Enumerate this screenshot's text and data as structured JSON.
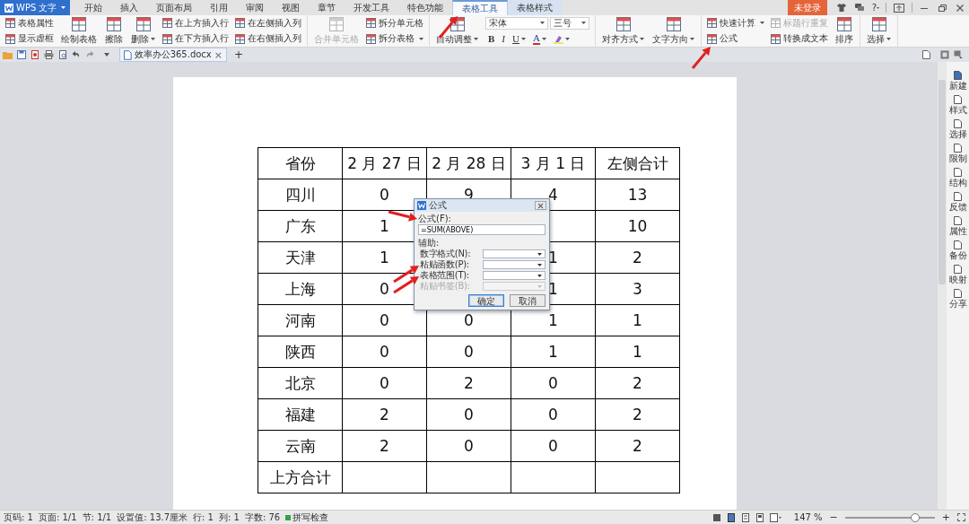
{
  "app_button": {
    "label": "WPS 文字"
  },
  "menu_tabs": [
    {
      "label": "开始",
      "selected": false,
      "contextual": false,
      "arrow": false
    },
    {
      "label": "插入",
      "selected": false,
      "contextual": false,
      "arrow": false
    },
    {
      "label": "页面布局",
      "selected": false,
      "contextual": false,
      "arrow": false
    },
    {
      "label": "引用",
      "selected": false,
      "contextual": false,
      "arrow": false
    },
    {
      "label": "审阅",
      "selected": false,
      "contextual": false,
      "arrow": false
    },
    {
      "label": "视图",
      "selected": false,
      "contextual": false,
      "arrow": false
    },
    {
      "label": "章节",
      "selected": false,
      "contextual": false,
      "arrow": false
    },
    {
      "label": "开发工具",
      "selected": false,
      "contextual": false,
      "arrow": false
    },
    {
      "label": "特色功能",
      "selected": false,
      "contextual": false,
      "arrow": false
    },
    {
      "label": "表格工具",
      "selected": true,
      "contextual": true,
      "arrow": true
    },
    {
      "label": "表格样式",
      "selected": false,
      "contextual": true,
      "arrow": false
    }
  ],
  "login_button": {
    "label": "未登录"
  },
  "help_button": {
    "label": "?"
  },
  "ribbon": {
    "groups": [
      {
        "columns": [
          {
            "kind": "stack",
            "items": [
              {
                "label": "表格属性",
                "dropdown": false,
                "disabled": false
              },
              {
                "label": "显示虚框",
                "dropdown": false,
                "disabled": false
              }
            ]
          },
          {
            "kind": "large",
            "label": "绘制表格",
            "dropdown": false,
            "disabled": false
          },
          {
            "kind": "large",
            "label": "擦除",
            "dropdown": false,
            "disabled": false
          },
          {
            "kind": "large",
            "label": "删除",
            "dropdown": true,
            "disabled": false
          },
          {
            "kind": "stack",
            "items": [
              {
                "label": "在上方插入行",
                "dropdown": false,
                "disabled": false
              },
              {
                "label": "在下方插入行",
                "dropdown": false,
                "disabled": false
              }
            ]
          },
          {
            "kind": "stack",
            "items": [
              {
                "label": "在左侧插入列",
                "dropdown": false,
                "disabled": false
              },
              {
                "label": "在右侧插入列",
                "dropdown": false,
                "disabled": false
              }
            ]
          }
        ]
      },
      {
        "columns": [
          {
            "kind": "large",
            "label": "合并单元格",
            "dropdown": false,
            "disabled": true
          },
          {
            "kind": "stack",
            "items": [
              {
                "label": "拆分单元格",
                "dropdown": false,
                "disabled": false
              },
              {
                "label": "拆分表格",
                "dropdown": true,
                "disabled": false
              }
            ]
          }
        ]
      },
      {
        "columns": [
          {
            "kind": "large",
            "label": "自动调整",
            "dropdown": true,
            "disabled": false
          },
          {
            "kind": "font",
            "font_name": "宋体",
            "font_size": "三号",
            "format_buttons": [
              {
                "label": "B",
                "dropdown": false
              },
              {
                "label": "I",
                "dropdown": false
              },
              {
                "label": "U",
                "dropdown": true
              },
              {
                "label": "A",
                "dropdown": true
              }
            ]
          }
        ]
      },
      {
        "columns": [
          {
            "kind": "large",
            "label": "对齐方式",
            "dropdown": true,
            "disabled": false
          },
          {
            "kind": "large",
            "label": "文字方向",
            "dropdown": true,
            "disabled": false
          }
        ]
      },
      {
        "columns": [
          {
            "kind": "stack",
            "items": [
              {
                "label": "快速计算",
                "dropdown": true,
                "disabled": false,
                "arrow": false
              },
              {
                "label": "公式",
                "dropdown": false,
                "disabled": false,
                "arrow": true
              }
            ]
          },
          {
            "kind": "stack",
            "items": [
              {
                "label": "标题行重复",
                "dropdown": false,
                "disabled": true
              },
              {
                "label": "转换成文本",
                "dropdown": false,
                "disabled": false
              }
            ]
          },
          {
            "kind": "large",
            "label": "排序",
            "dropdown": false,
            "disabled": false
          }
        ]
      },
      {
        "columns": [
          {
            "kind": "large",
            "label": "选择",
            "dropdown": true,
            "disabled": false
          }
        ]
      }
    ]
  },
  "document_tabs": {
    "tab": {
      "label": "效率办公365.docx",
      "close": "×"
    },
    "new_tab": "+"
  },
  "table": {
    "header": [
      "省份",
      "2 月 27 日",
      "2 月 28 日",
      "3 月 1 日",
      "左侧合计"
    ],
    "rows": [
      [
        "四川",
        "0",
        "9",
        "4",
        "13"
      ],
      [
        "广东",
        "1",
        null,
        null,
        "10"
      ],
      [
        "天津",
        "1",
        null,
        "1",
        "2"
      ],
      [
        "上海",
        "0",
        null,
        "1",
        "3"
      ],
      [
        "河南",
        "0",
        "0",
        "1",
        "1"
      ],
      [
        "陕西",
        "0",
        "0",
        "1",
        "1"
      ],
      [
        "北京",
        "0",
        "2",
        "0",
        "2"
      ],
      [
        "福建",
        "2",
        "0",
        "0",
        "2"
      ],
      [
        "云南",
        "2",
        "0",
        "0",
        "2"
      ],
      [
        "上方合计",
        null,
        null,
        null,
        null
      ]
    ]
  },
  "dialog": {
    "title": "公式",
    "formula_label": {
      "label": "公式(F):",
      "arrow": true
    },
    "formula": "=SUM(ABOVE)",
    "section": "辅助:",
    "rows": [
      {
        "label": "数字格式(N):",
        "disabled": false,
        "arrow": false
      },
      {
        "label": "粘贴函数(P):",
        "disabled": false,
        "arrow": true
      },
      {
        "label": "表格范围(T):",
        "disabled": false,
        "arrow": true
      },
      {
        "label": "粘贴书签(B):",
        "disabled": true,
        "arrow": false
      }
    ],
    "buttons": [
      {
        "label": "确定",
        "default": true
      },
      {
        "label": "取消",
        "default": false
      }
    ]
  },
  "sidebar": {
    "items": [
      {
        "label": "新建"
      },
      {
        "label": "样式"
      },
      {
        "label": "选择"
      },
      {
        "label": "限制"
      },
      {
        "label": "结构"
      },
      {
        "label": "反馈"
      },
      {
        "label": "属性"
      },
      {
        "label": "备份"
      },
      {
        "label": "映射"
      },
      {
        "label": "分享"
      }
    ]
  },
  "status_bar": {
    "items": [
      "页码: 1",
      "页面: 1/1",
      "节: 1/1",
      "设置值: 13.7厘米",
      "行: 1",
      "列: 1",
      "字数: 76"
    ],
    "spell_check": "拼写检查",
    "zoom": "147 %",
    "zoom_out": "−",
    "zoom_in": "+",
    "zoom_slider": {
      "level": 0.78
    }
  }
}
